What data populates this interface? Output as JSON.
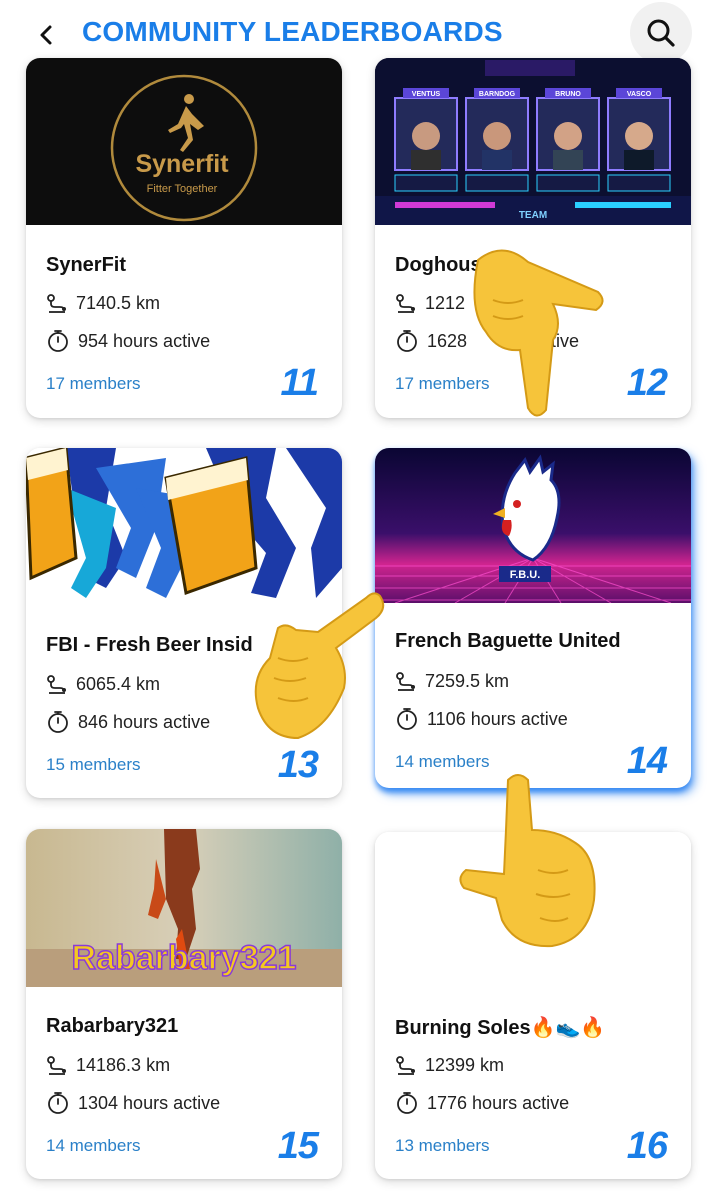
{
  "header": {
    "title": "COMMUNITY LEADERBOARDS",
    "back_icon": "chevron-left-icon",
    "search_icon": "search-icon"
  },
  "cards": [
    {
      "name": "SynerFit",
      "distance": "7140.5 km",
      "hours": "954 hours active",
      "members": "17 members",
      "rank": "11",
      "image_text": "Synerfit",
      "image_subtext": "Fitter Together"
    },
    {
      "name": "Doghouse",
      "distance": "1212",
      "hours": "1628",
      "hours_suffix": "tive",
      "members": "17 members",
      "rank": "12",
      "image_labels": [
        "VENTUS",
        "BARNDOG",
        "BRUNO",
        "VASCO"
      ],
      "image_bottom": "TEAM"
    },
    {
      "name": "FBI - Fresh Beer Insid",
      "distance": "6065.4 km",
      "hours": "846 hours active",
      "members": "15 members",
      "rank": "13"
    },
    {
      "name": "French Baguette United",
      "distance": "7259.5 km",
      "hours": "1106 hours active",
      "members": "14 members",
      "rank": "14",
      "image_text": "F.B.U."
    },
    {
      "name": "Rabarbary321",
      "distance": "14186.3 km",
      "hours": "1304 hours active",
      "members": "14 members",
      "rank": "15",
      "image_text": "Rabarbary321"
    },
    {
      "name": "Burning Soles🔥👟🔥",
      "distance": "12399 km",
      "hours": "1776 hours active",
      "members": "13 members",
      "rank": "16"
    }
  ],
  "icons": {
    "distance": "route-icon",
    "time": "stopwatch-icon",
    "pointer": "pointing-hand-emoji"
  },
  "colors": {
    "accent": "#1a7ee8",
    "members": "#2a80c8",
    "highlight_glow": "#1a78f0"
  }
}
